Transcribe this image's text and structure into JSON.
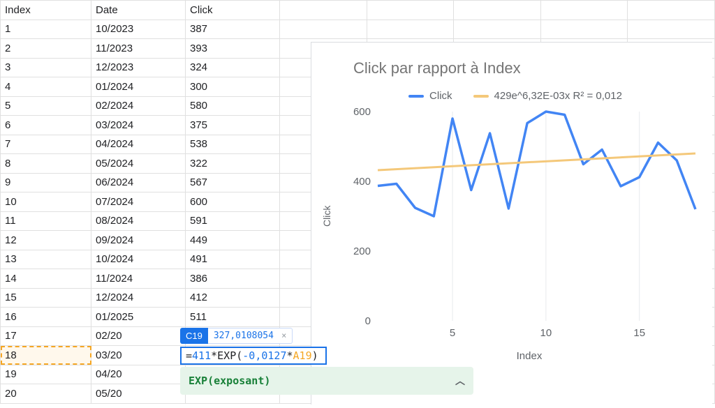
{
  "columns": {
    "index": "Index",
    "date": "Date",
    "click": "Click"
  },
  "rows": [
    {
      "index": 1,
      "date": "10/2023",
      "click": "387"
    },
    {
      "index": 2,
      "date": "11/2023",
      "click": "393"
    },
    {
      "index": 3,
      "date": "12/2023",
      "click": "324"
    },
    {
      "index": 4,
      "date": "01/2024",
      "click": "300"
    },
    {
      "index": 5,
      "date": "02/2024",
      "click": "580"
    },
    {
      "index": 6,
      "date": "03/2024",
      "click": "375"
    },
    {
      "index": 7,
      "date": "04/2024",
      "click": "538"
    },
    {
      "index": 8,
      "date": "05/2024",
      "click": "322"
    },
    {
      "index": 9,
      "date": "06/2024",
      "click": "567"
    },
    {
      "index": 10,
      "date": "07/2024",
      "click": "600"
    },
    {
      "index": 11,
      "date": "08/2024",
      "click": "591"
    },
    {
      "index": 12,
      "date": "09/2024",
      "click": "449"
    },
    {
      "index": 13,
      "date": "10/2024",
      "click": "491"
    },
    {
      "index": 14,
      "date": "11/2024",
      "click": "386"
    },
    {
      "index": 15,
      "date": "12/2024",
      "click": "412"
    },
    {
      "index": 16,
      "date": "01/2025",
      "click": "511"
    },
    {
      "index": 17,
      "date": "02/20",
      "click": ""
    },
    {
      "index": 18,
      "date": "03/20",
      "click": ""
    },
    {
      "index": 19,
      "date": "04/20",
      "click": ""
    },
    {
      "index": 20,
      "date": "05/20",
      "click": ""
    }
  ],
  "formula_edit": {
    "cell_ref": "C19",
    "preview_value": "327,0108054",
    "parts": {
      "eq": "=",
      "n1": "411",
      "star": "*",
      "fn": "EXP",
      "open": "(",
      "n2": "-0,0127",
      "star2": "*",
      "ref": "A19",
      "close": ")"
    },
    "helper_text": "EXP(exposant)"
  },
  "chart_data": {
    "type": "line",
    "title": "Click par rapport à Index",
    "xlabel": "Index",
    "ylabel": "Click",
    "ylim": [
      0,
      600
    ],
    "xlim": [
      1,
      18
    ],
    "xticks": [
      5,
      10,
      15
    ],
    "yticks": [
      0,
      200,
      400,
      600
    ],
    "series": [
      {
        "name": "Click",
        "color": "#4285f4",
        "x": [
          1,
          2,
          3,
          4,
          5,
          6,
          7,
          8,
          9,
          10,
          11,
          12,
          13,
          14,
          15,
          16,
          17,
          18
        ],
        "values": [
          387,
          393,
          324,
          300,
          580,
          375,
          538,
          322,
          567,
          600,
          591,
          449,
          491,
          386,
          412,
          511,
          460,
          320
        ]
      },
      {
        "name": "429e^6,32E-03x R² = 0,012",
        "color": "#f4c87a",
        "type": "trend",
        "x": [
          1,
          18
        ],
        "values": [
          432,
          480
        ]
      }
    ]
  }
}
